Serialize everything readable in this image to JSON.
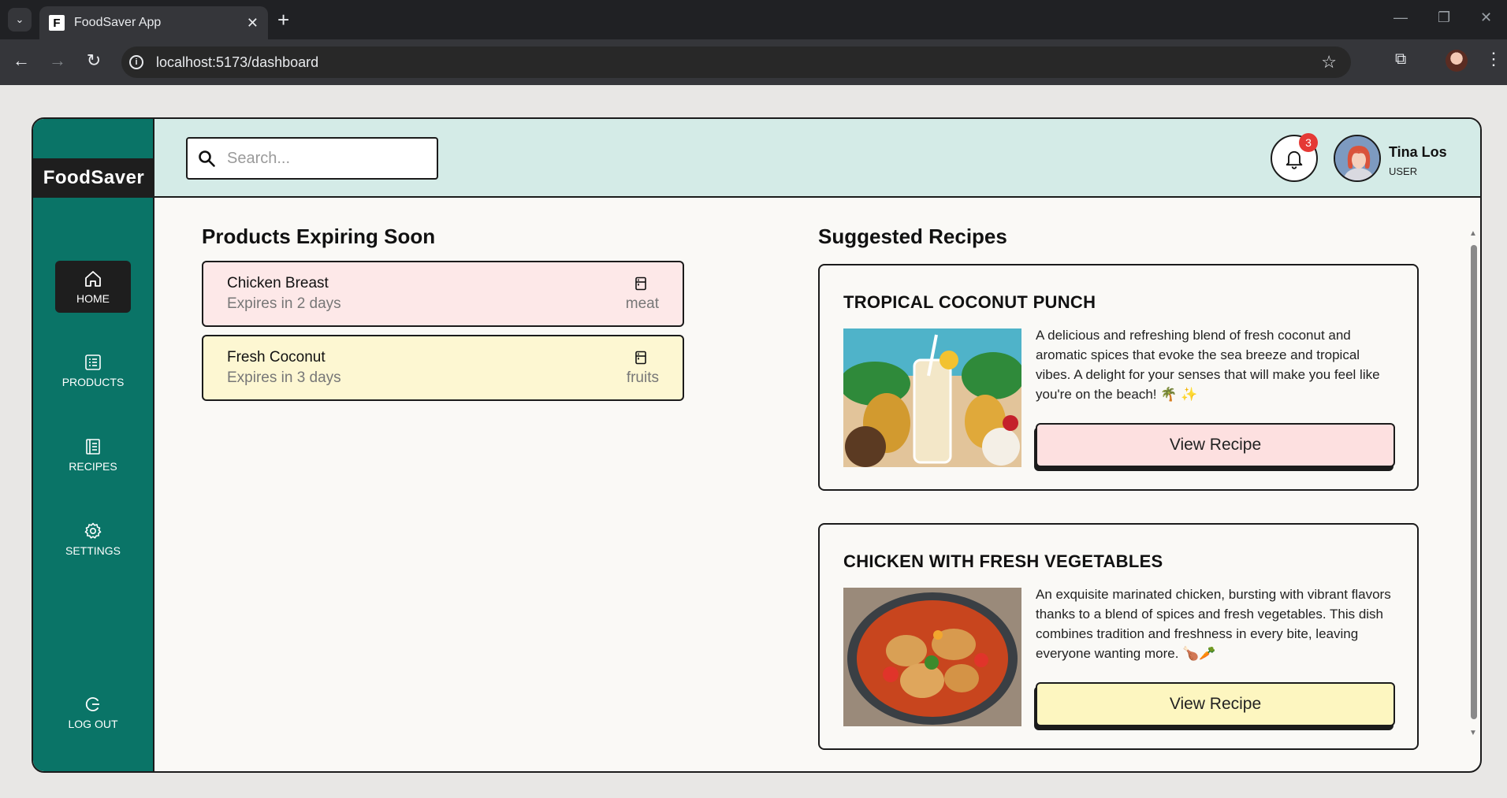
{
  "browser": {
    "tab_title": "FoodSaver App",
    "favicon_letter": "F",
    "url": "localhost:5173/dashboard"
  },
  "app": {
    "logo": "FoodSaver",
    "nav": [
      {
        "label": "HOME",
        "icon": "home-icon",
        "active": true
      },
      {
        "label": "PRODUCTS",
        "icon": "list-icon"
      },
      {
        "label": "RECIPES",
        "icon": "book-icon"
      },
      {
        "label": "SETTINGS",
        "icon": "gear-icon"
      }
    ],
    "logout_label": "LOG OUT"
  },
  "header": {
    "search_placeholder": "Search...",
    "notifications_count": "3",
    "user_name": "Tina Los",
    "user_role": "USER"
  },
  "products": {
    "title": "Products Expiring Soon",
    "items": [
      {
        "name": "Chicken Breast",
        "expires": "Expires in 2 days",
        "category": "meat",
        "bg": "#fde8e8"
      },
      {
        "name": "Fresh Coconut",
        "expires": "Expires in 3 days",
        "category": "fruits",
        "bg": "#fdf7d2"
      }
    ]
  },
  "recipes": {
    "title": "Suggested Recipes",
    "items": [
      {
        "title": "TROPICAL COCONUT PUNCH",
        "description": "A delicious and refreshing blend of fresh coconut and aromatic spices that evoke the sea breeze and tropical vibes. A delight for your senses that will make you feel like you're on the beach! 🌴 ✨",
        "button": "View Recipe",
        "button_bg": "#fde0e0"
      },
      {
        "title": "CHICKEN WITH FRESH VEGETABLES",
        "description": "An exquisite marinated chicken, bursting with vibrant flavors thanks to a blend of spices and fresh vegetables. This dish combines tradition and freshness in every bite, leaving everyone wanting more. 🍗🥕",
        "button": "View Recipe",
        "button_bg": "#fdf6c0"
      }
    ]
  }
}
